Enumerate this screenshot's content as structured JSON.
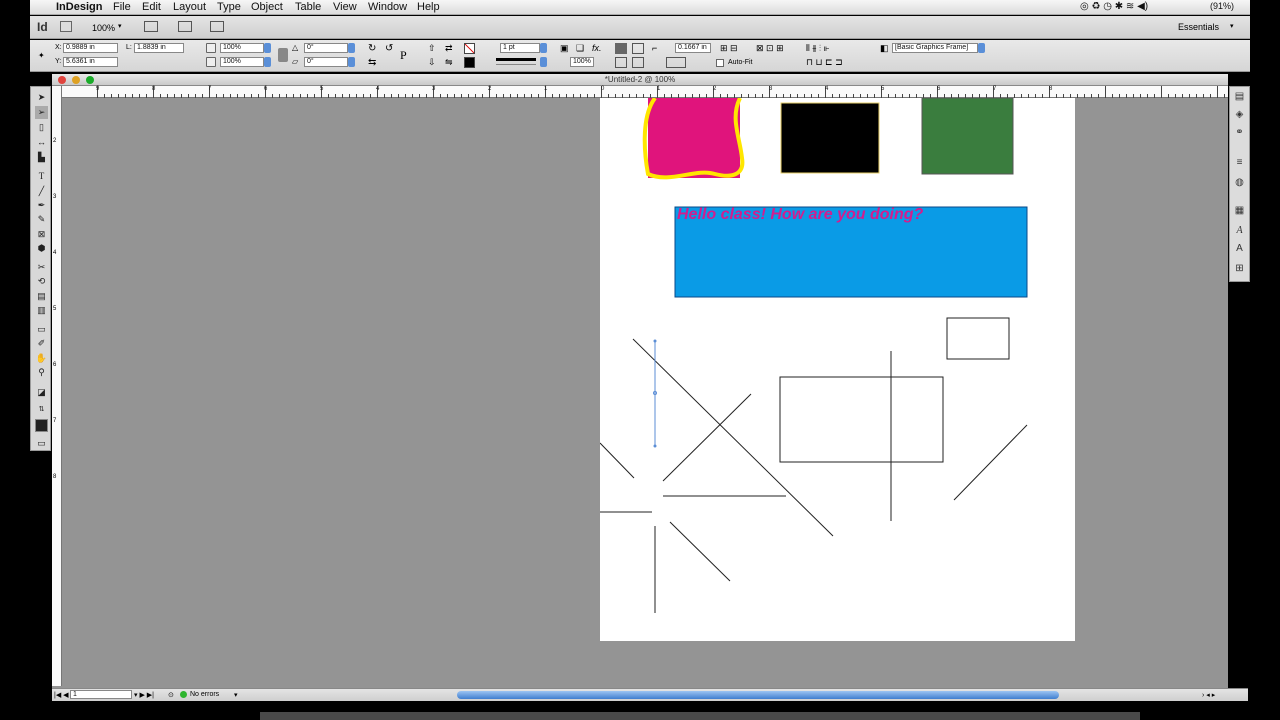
{
  "menubar": {
    "app": "InDesign",
    "items": [
      "File",
      "Edit",
      "Layout",
      "Type",
      "Object",
      "Table",
      "View",
      "Window",
      "Help"
    ],
    "battery": "(91%)"
  },
  "appbar": {
    "logo": "Id",
    "zoom": "100%",
    "workspace": "Essentials"
  },
  "control": {
    "x": "0.9889 in",
    "y": "5.6361 in",
    "w": "1.8839 in",
    "scale_x": "100%",
    "scale_y": "100%",
    "angle": "0°",
    "shear": "0°",
    "stroke": "1 pt",
    "ref_value": "0.1667 in",
    "percent": "100%",
    "autofit": "Auto-Fit",
    "style": "[Basic Graphics Frame]"
  },
  "document": {
    "title": "*Untitled-2 @ 100%",
    "ruler_labels": [
      "9",
      "8",
      "7",
      "6",
      "5",
      "4",
      "3",
      "2",
      "1",
      "0",
      "1",
      "2",
      "3",
      "4",
      "5",
      "6",
      "7",
      "8"
    ],
    "vruler_labels": [
      "2",
      "3",
      "4",
      "5",
      "6",
      "7",
      "8"
    ]
  },
  "page": {
    "text_frame": {
      "text": "Hello class! How are you doing?",
      "fill": "#0a9be6",
      "text_color": "#d11e8f"
    },
    "colors": {
      "magenta": "#e0147c",
      "black": "#000000",
      "green": "#3a7d3e",
      "yellow": "#ffe600"
    }
  },
  "status": {
    "page": "1",
    "preflight": "No errors"
  }
}
